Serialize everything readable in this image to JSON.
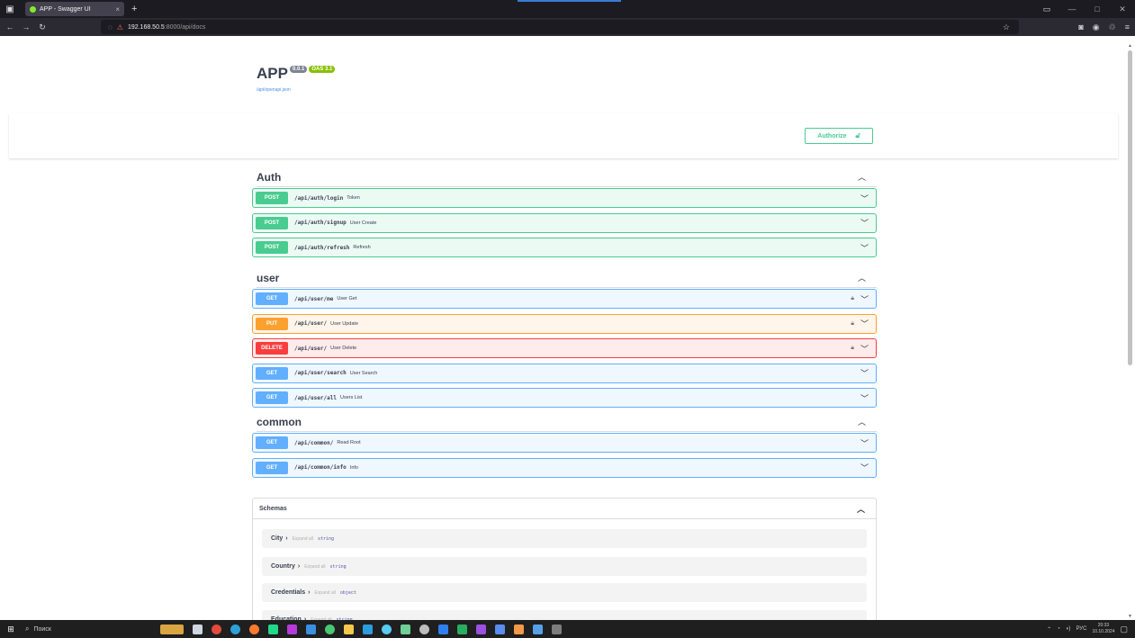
{
  "browser": {
    "tab_title": "APP - Swagger UI",
    "tab_close": "×",
    "new_tab": "+",
    "url_host": "192.168.50.5",
    "url_path": ":8000/api/docs"
  },
  "info": {
    "title": "APP",
    "version": "0.0.1",
    "oas": "OAS 3.1",
    "spec_link": "/api/openapi.json"
  },
  "authorize_label": "Authorize",
  "tags": [
    {
      "name": "Auth",
      "ops": [
        {
          "method": "POST",
          "path": "/api/auth/login",
          "summary": "Token",
          "locked": false
        },
        {
          "method": "POST",
          "path": "/api/auth/signup",
          "summary": "User Create",
          "locked": false
        },
        {
          "method": "POST",
          "path": "/api/auth/refresh",
          "summary": "Refresh",
          "locked": false
        }
      ]
    },
    {
      "name": "user",
      "ops": [
        {
          "method": "GET",
          "path": "/api/user/me",
          "summary": "User Get",
          "locked": true
        },
        {
          "method": "PUT",
          "path": "/api/user/",
          "summary": "User Update",
          "locked": true
        },
        {
          "method": "DELETE",
          "path": "/api/user/",
          "summary": "User Delete",
          "locked": true
        },
        {
          "method": "GET",
          "path": "/api/user/search",
          "summary": "User Search",
          "locked": false
        },
        {
          "method": "GET",
          "path": "/api/user/all",
          "summary": "Users List",
          "locked": false
        }
      ]
    },
    {
      "name": "common",
      "ops": [
        {
          "method": "GET",
          "path": "/api/common/",
          "summary": "Read Root",
          "locked": false
        },
        {
          "method": "GET",
          "path": "/api/common/info",
          "summary": "Info",
          "locked": false
        }
      ]
    }
  ],
  "schemas": {
    "title": "Schemas",
    "expand_label": "Expand all",
    "items": [
      {
        "name": "City",
        "type": "string"
      },
      {
        "name": "Country",
        "type": "string"
      },
      {
        "name": "Credentials",
        "type": "object"
      },
      {
        "name": "Education",
        "type": "string"
      }
    ]
  },
  "taskbar": {
    "search_label": "Поиск",
    "lang": "РУС",
    "time": "20:33",
    "date": "10.10.2024"
  },
  "colors": {
    "post": "#49cc90",
    "get": "#61affe",
    "put": "#fca130",
    "delete": "#f93e3e"
  }
}
